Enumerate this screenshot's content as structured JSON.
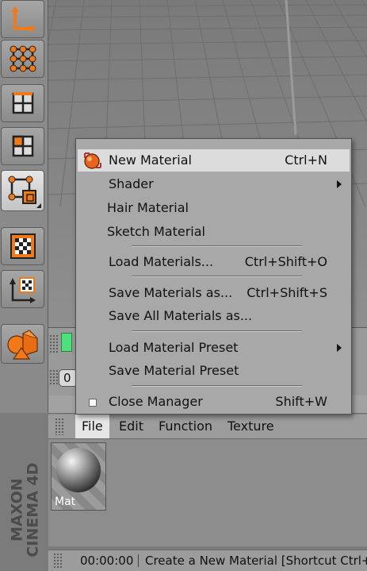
{
  "toolbar": {
    "tools": [
      {
        "name": "axis-icon"
      },
      {
        "name": "points-mode-icon"
      },
      {
        "name": "edges-mode-icon"
      },
      {
        "name": "polygons-mode-icon"
      },
      {
        "name": "object-mode-icon",
        "active": true
      },
      {
        "name": "texture-mode-icon"
      },
      {
        "name": "texture-axis-icon"
      },
      {
        "name": "primitives-icon"
      }
    ]
  },
  "timeline": {
    "frame": "0"
  },
  "context_menu": {
    "items": [
      {
        "label": "New Material",
        "shortcut": "Ctrl+N",
        "highlighted": true,
        "icon": "new-material-icon"
      },
      {
        "label": "Shader",
        "submenu": true
      },
      {
        "label": "Hair Material"
      },
      {
        "label": "Sketch Material"
      },
      {
        "label": "Load Materials...",
        "shortcut": "Ctrl+Shift+O"
      },
      {
        "label": "Save Materials as...",
        "shortcut": "Ctrl+Shift+S"
      },
      {
        "label": "Save All Materials as..."
      },
      {
        "label": "Load Material Preset",
        "submenu": true
      },
      {
        "label": "Save Material Preset"
      },
      {
        "label": "Close Manager",
        "shortcut": "Shift+W",
        "icon": "close-manager-icon"
      }
    ]
  },
  "manager": {
    "menu": [
      "File",
      "Edit",
      "Function",
      "Texture"
    ],
    "active_menu": "File",
    "material": {
      "name": "Mat"
    }
  },
  "logo": {
    "text_line1": "MAXON",
    "text_line2": "CINEMA 4D"
  },
  "status": {
    "time": "00:00:00",
    "message": "Create a New Material [Shortcut Ctrl+N]"
  },
  "colors": {
    "accent_orange": "#f07a1a",
    "timeline_green": "#4fe07d",
    "menu_bg": "#a8a8a8",
    "menu_highlight": "#dcdcdc"
  }
}
